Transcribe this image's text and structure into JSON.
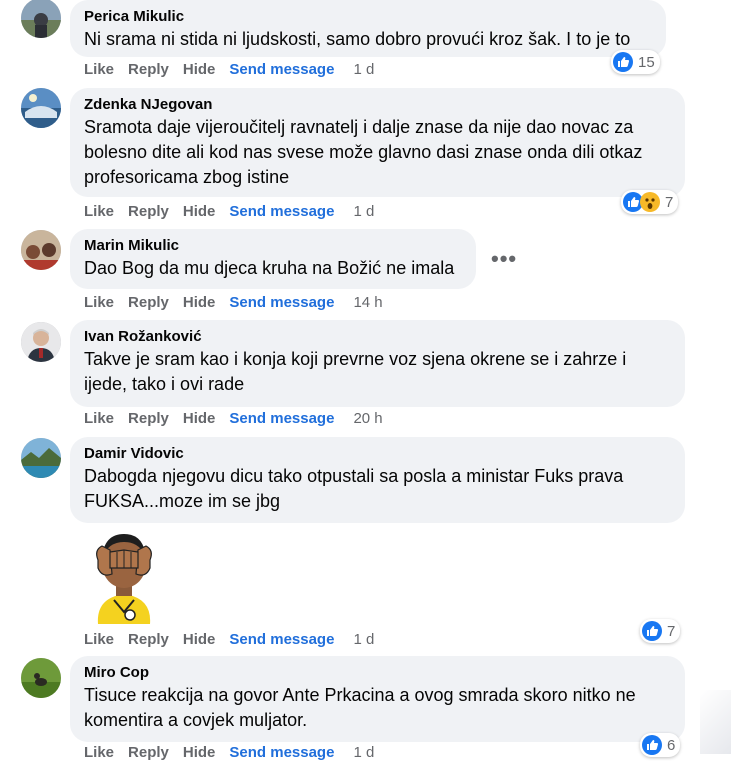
{
  "actions": {
    "like": "Like",
    "reply": "Reply",
    "hide": "Hide",
    "send_message": "Send message"
  },
  "comments": [
    {
      "author": "Perica Mikulic",
      "lines": [
        "Ni srama ni stida ni ljudskosti, samo dobro provući kroz šak. I to je to"
      ],
      "time": "1 d",
      "reactions": "15",
      "reaction_types": [
        "like"
      ]
    },
    {
      "author": "Zdenka NJegovan",
      "lines": [
        "Sramota daje vijeroučitelj ravnatelj i dalje znase da nije dao novac za",
        "bolesno dite ali kod nas svese može glavno dasi znase onda dili otkaz",
        "profesoricama zbog istine"
      ],
      "time": "1 d",
      "reactions": "7",
      "reaction_types": [
        "like",
        "wow"
      ]
    },
    {
      "author": "Marin Mikulic",
      "lines": [
        "Dao Bog da mu djeca kruha na Božić ne imala"
      ],
      "time": "14 h",
      "reactions": "",
      "reaction_types": [],
      "more": "•••"
    },
    {
      "author": "Ivan Rožanković",
      "lines": [
        "Takve je sram kao i konja koji prevrne voz sjena okrene se i zahrze i",
        "ijede, tako i ovi rade"
      ],
      "time": "20 h",
      "reactions": "",
      "reaction_types": []
    },
    {
      "author": "Damir Vidovic",
      "lines": [
        "Dabogda njegovu dicu tako otpustali sa posla a ministar Fuks prava",
        "FUKSA...moze im se jbg"
      ],
      "time": "1 d",
      "reactions": "7",
      "reaction_types": [
        "like"
      ]
    },
    {
      "author": "Miro Cop",
      "lines": [
        "Tisuce reakcija na govor Ante Prkacina a ovog smrada skoro nitko ne",
        "komentira a covjek muljator."
      ],
      "time": "1 d",
      "reactions": "6",
      "reaction_types": [
        "like"
      ]
    }
  ],
  "icons": {
    "like": "like-reaction-icon",
    "wow": "wow-reaction-icon",
    "sticker": "covering-eyes-sticker"
  },
  "colors": {
    "bubble": "#f0f2f5",
    "link": "#216fdb",
    "meta": "#65676b",
    "like_blue": "#1877f2"
  }
}
